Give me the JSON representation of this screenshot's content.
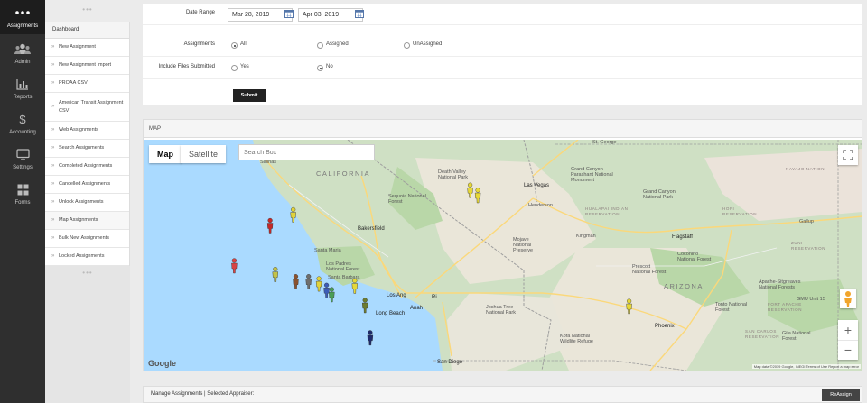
{
  "rail": [
    {
      "label": "Assignments",
      "icon": "dots-icon",
      "active": true
    },
    {
      "label": "Admin",
      "icon": "users-icon"
    },
    {
      "label": "Reports",
      "icon": "bar-chart-icon"
    },
    {
      "label": "Accounting",
      "icon": "dollar-icon"
    },
    {
      "label": "Settings",
      "icon": "monitor-icon"
    },
    {
      "label": "Forms",
      "icon": "grid-icon"
    }
  ],
  "sidebar": {
    "header": "Dashboard",
    "items": [
      "New Assignment",
      "New Assignment Import",
      "PROAA CSV",
      "American Transit Assignment CSV",
      "Web Assignments",
      "Search Assignments",
      "Completed Assignments",
      "Cancelled Assignments",
      "Unlock Assignments",
      "Map Assignments",
      "Bulk New Assignments",
      "Locked Assignments"
    ],
    "active_item": "Map Assignments"
  },
  "filters": {
    "date_range_label": "Date Range",
    "date_from": "Mar 28, 2019",
    "date_to": "Apr 03, 2019",
    "assignments_label": "Assignments",
    "assignment_options": [
      "All",
      "Assigned",
      "UnAssigned"
    ],
    "assignment_selected": "All",
    "include_files_label": "Include Files Submitted",
    "include_options": [
      "Yes",
      "No"
    ],
    "include_selected": "No",
    "submit_label": "Submit"
  },
  "map": {
    "panel_title": "MAP",
    "type_map": "Map",
    "type_satellite": "Satellite",
    "search_placeholder": "Search Box",
    "google": "Google",
    "attribution": "Map data ©2019 Google, INEGI   Terms of Use   Report a map error",
    "zoom_in": "+",
    "zoom_out": "−",
    "labels": {
      "california": "CALIFORNIA",
      "arizona": "ARIZONA",
      "salinas": "Salinas",
      "bakersfield": "Bakersfield",
      "santa_maria": "Santa Maria",
      "los_padres": "Los Padres National Forest",
      "santa_barbara": "Santa Barbara",
      "los_angeles": "Los Ang",
      "long_beach": "Long Beach",
      "anaheim": "Anah",
      "riverside": "Ri",
      "joshua_tree": "Joshua Tree National Park",
      "san_diego": "San Diego",
      "sequoia": "Sequoia National Forest",
      "death_valley": "Death Valley National Park",
      "mojave": "Mojave National Preserve",
      "las_vegas": "Las Vegas",
      "henderson": "Henderson",
      "grand_canyon_parashant": "Grand Canyon-Parashant National Monument",
      "grand_canyon_np": "Grand Canyon National Park",
      "kingman": "Kingman",
      "flagstaff": "Flagstaff",
      "prescott": "Prescott National Forest",
      "coconino": "Coconino National Forest",
      "phoenix": "Phoenix",
      "tonto": "Tonto National Forest",
      "apache": "Apache-Sitgreaves National Forests",
      "kofa": "Kofa National Wildlife Refuge",
      "gila": "Gila National Forest",
      "st_george": "St. George",
      "gallup": "Gallup",
      "navajo": "NAVAJO NATION",
      "hualapai": "HUALAPAI INDIAN RESERVATION",
      "hopi": "HOPI RESERVATION",
      "zuni": "ZUNI RESERVATION",
      "fort_apache": "FORT APACHE RESERVATION",
      "san_carlos": "SAN CARLOS RESERVATION",
      "gmu": "GMU Unit 15"
    },
    "colors": {
      "land": "#cfe0c4",
      "desert": "#eae6d9",
      "water": "#aadaff",
      "road": "#f2f2f2",
      "highway": "#fbd87a",
      "border": "#9e9e9e"
    },
    "markers": [
      {
        "lon": -120.45,
        "lat": 37.0,
        "color": "#3f4b8a"
      },
      {
        "lon": -119.05,
        "lat": 35.35,
        "color": "#c62828"
      },
      {
        "lon": -119.75,
        "lat": 34.42,
        "color": "#d84343"
      },
      {
        "lon": -118.95,
        "lat": 34.22,
        "color": "#c2c24a"
      },
      {
        "lon": -118.55,
        "lat": 34.05,
        "color": "#8a5230"
      },
      {
        "lon": -118.3,
        "lat": 34.05,
        "color": "#6e6e6e"
      },
      {
        "lon": -118.1,
        "lat": 34.0,
        "color": "#e0d23b"
      },
      {
        "lon": -117.95,
        "lat": 33.85,
        "color": "#3b5bb7"
      },
      {
        "lon": -117.85,
        "lat": 33.75,
        "color": "#4a9d57"
      },
      {
        "lon": -117.4,
        "lat": 33.95,
        "color": "#e6d838"
      },
      {
        "lon": -117.2,
        "lat": 33.5,
        "color": "#6d7c2f"
      },
      {
        "lon": -117.1,
        "lat": 32.75,
        "color": "#1e2a6b"
      },
      {
        "lon": -118.6,
        "lat": 35.6,
        "color": "#e0d23b"
      },
      {
        "lon": -115.15,
        "lat": 36.17,
        "color": "#e6d838"
      },
      {
        "lon": -115.0,
        "lat": 36.05,
        "color": "#e6d838"
      },
      {
        "lon": -112.05,
        "lat": 33.48,
        "color": "#e6d838"
      }
    ]
  },
  "manage": {
    "label": "Manage Assignments | Selected Appraiser:",
    "reassign_label": "ReAssign"
  }
}
